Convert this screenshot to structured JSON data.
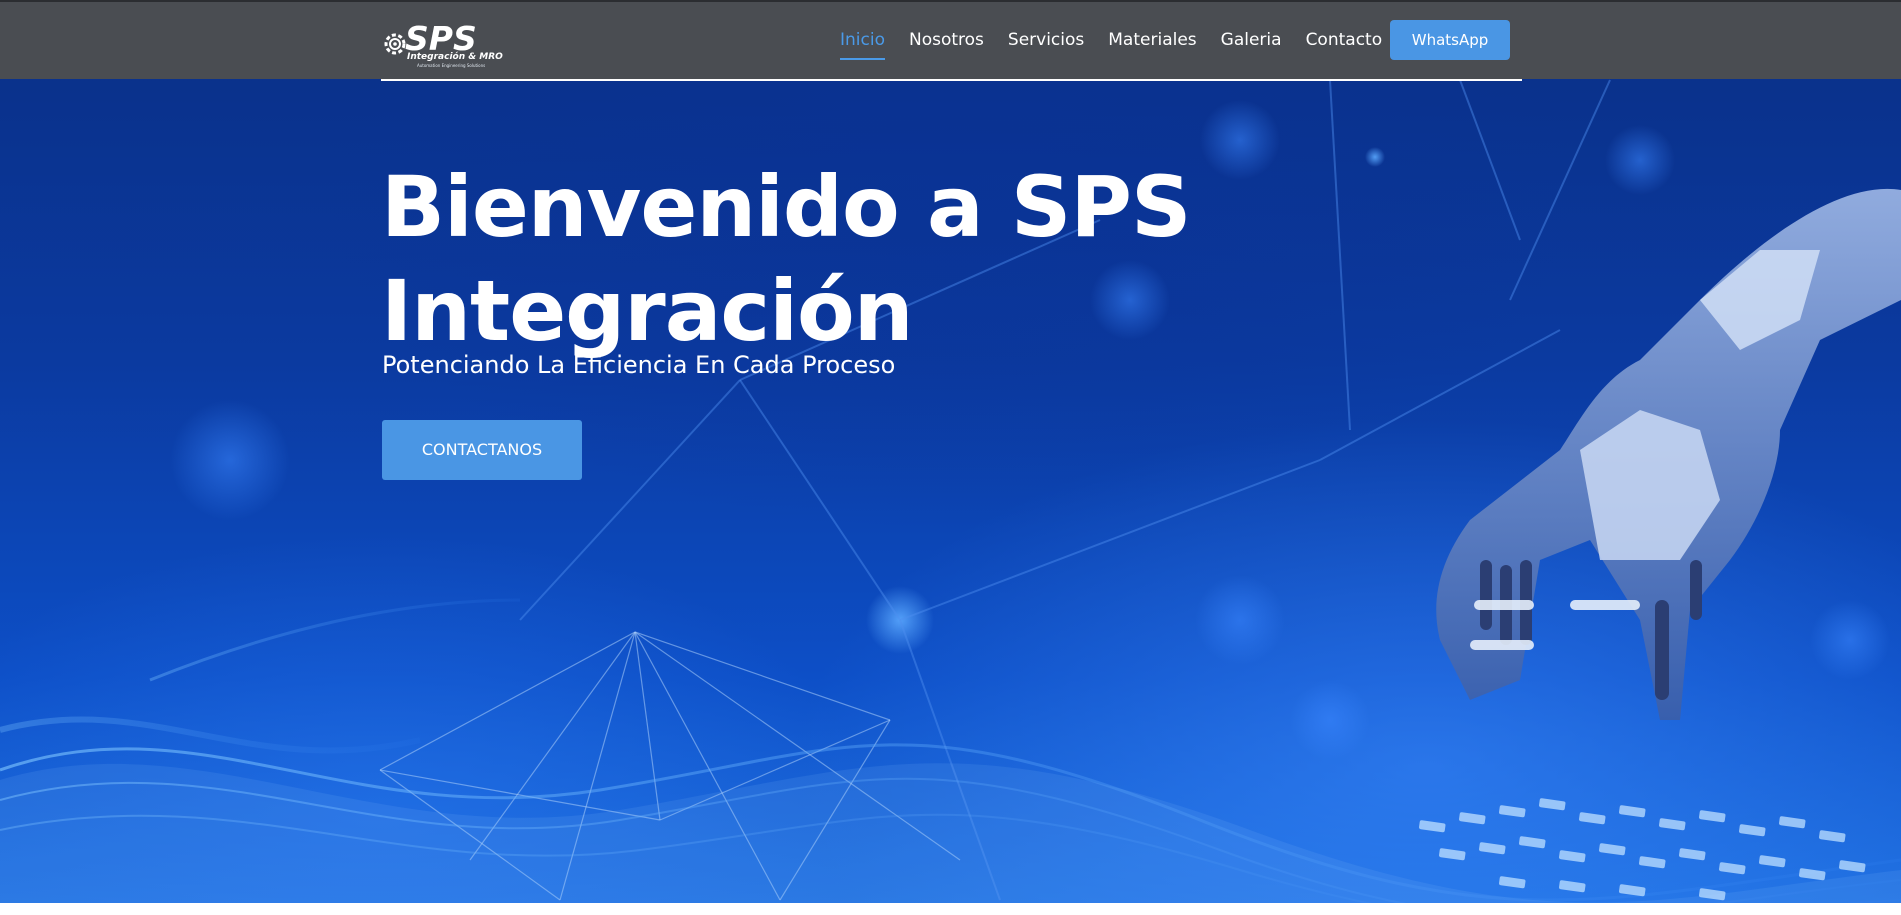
{
  "brand": {
    "logo_text": "SPS",
    "logo_subtitle": "Integración & MRO",
    "logo_tagline": "Automation Engineering Solutions"
  },
  "nav": {
    "items": [
      {
        "label": "Inicio",
        "active": true
      },
      {
        "label": "Nosotros",
        "active": false
      },
      {
        "label": "Servicios",
        "active": false
      },
      {
        "label": "Materiales",
        "active": false
      },
      {
        "label": "Galeria",
        "active": false
      },
      {
        "label": "Contacto",
        "active": false
      }
    ],
    "whatsapp_label": "WhatsApp"
  },
  "hero": {
    "title_line1": "Bienvenido a SPS",
    "title_line2": "Integración",
    "subtitle": "Potenciando La Eficiencia En Cada Proceso",
    "cta_label": "CONTACTANOS"
  },
  "colors": {
    "navbar_bg": "#4a4d52",
    "accent": "#4a96e4",
    "active_link": "#4a9ae8",
    "hero_bg": "#0b3aa0"
  },
  "icons": {
    "logo_gear": "gear-icon",
    "hero_image": "robot-hand-illustration"
  }
}
